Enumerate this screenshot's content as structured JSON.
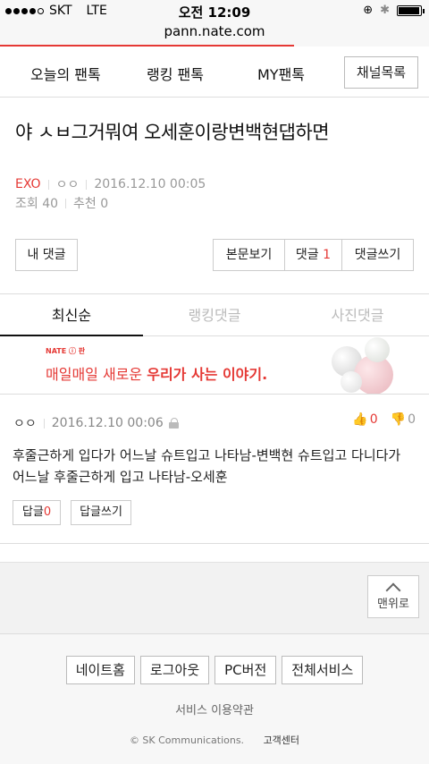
{
  "status_bar": {
    "carrier": "SKT",
    "network": "LTE",
    "time": "오전 12:09",
    "battery_level": 0.95
  },
  "url_bar": {
    "url": "pann.nate.com",
    "load_progress": 0.685
  },
  "top_nav": {
    "items": [
      "오늘의 팬톡",
      "랭킹 팬톡",
      "MY팬톡"
    ],
    "channel_button": "채널목록"
  },
  "post": {
    "title": "야 ㅅㅂ그거뭐여 오세훈이랑변백현댑하면",
    "channel": "EXO",
    "author": "ㅇㅇ",
    "datetime": "2016.12.10 00:05",
    "views_label": "조회 40",
    "recommend_label": "추천 0"
  },
  "actions": {
    "my_comments": "내 댓글",
    "view_body": "본문보기",
    "comments_label": "댓글",
    "comments_count": "1",
    "write_comment": "댓글쓰기"
  },
  "tabs": [
    "최신순",
    "랭킹댓글",
    "사진댓글"
  ],
  "banner": {
    "logo": "NATE ⓘ 판",
    "text_normal": "매일매일 새로운 ",
    "text_bold": "우리가 사는 이야기."
  },
  "comment": {
    "author": "ㅇㅇ",
    "datetime": "2016.12.10 00:06",
    "likes": "0",
    "dislikes": "0",
    "body": "후줄근하게 입다가 어느날 슈트입고 나타남-변백현 슈트입고 다니다가 어느날 후줄근하게 입고 나타남-오세훈",
    "reply_label": "답글",
    "reply_count": "0",
    "write_reply": "답글쓰기"
  },
  "top_button": "맨위로",
  "footer": {
    "links": [
      "네이트홈",
      "로그아웃",
      "PC버전",
      "전체서비스"
    ],
    "terms": "서비스 이용약관",
    "copyright": "© SK Communications.",
    "customer_center": "고객센터"
  },
  "colors": {
    "accent": "#e53935"
  }
}
